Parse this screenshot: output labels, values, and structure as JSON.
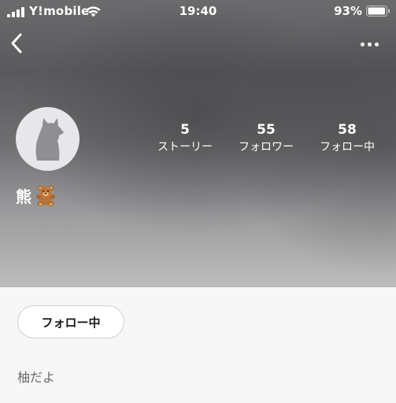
{
  "status_bar": {
    "carrier": "Y!mobile",
    "time": "19:40",
    "battery_percent": "93%",
    "icons": [
      "signal-icon",
      "wifi-icon",
      "battery-icon"
    ]
  },
  "nav": {
    "back_icon": "chevron-left-icon",
    "more_icon": "more-horizontal-icon"
  },
  "profile": {
    "avatar_icon": "cat-silhouette-icon",
    "name": "熊🧸",
    "name_text": "熊",
    "name_emoji_icon": "teddy-bear-icon",
    "stats": [
      {
        "value": "5",
        "label": "ストーリー"
      },
      {
        "value": "55",
        "label": "フォロワー"
      },
      {
        "value": "58",
        "label": "フォロー中"
      }
    ]
  },
  "actions": {
    "follow_label": "フォロー中"
  },
  "bio": "柚だよ",
  "colors": {
    "header_gray": "#6f6f71",
    "page_background": "#f7f7f7",
    "button_border": "#cfcfd3",
    "bio_text": "#6a6a6e",
    "avatar_background": "#e7e7ea",
    "avatar_silhouette": "#8e8e93"
  }
}
